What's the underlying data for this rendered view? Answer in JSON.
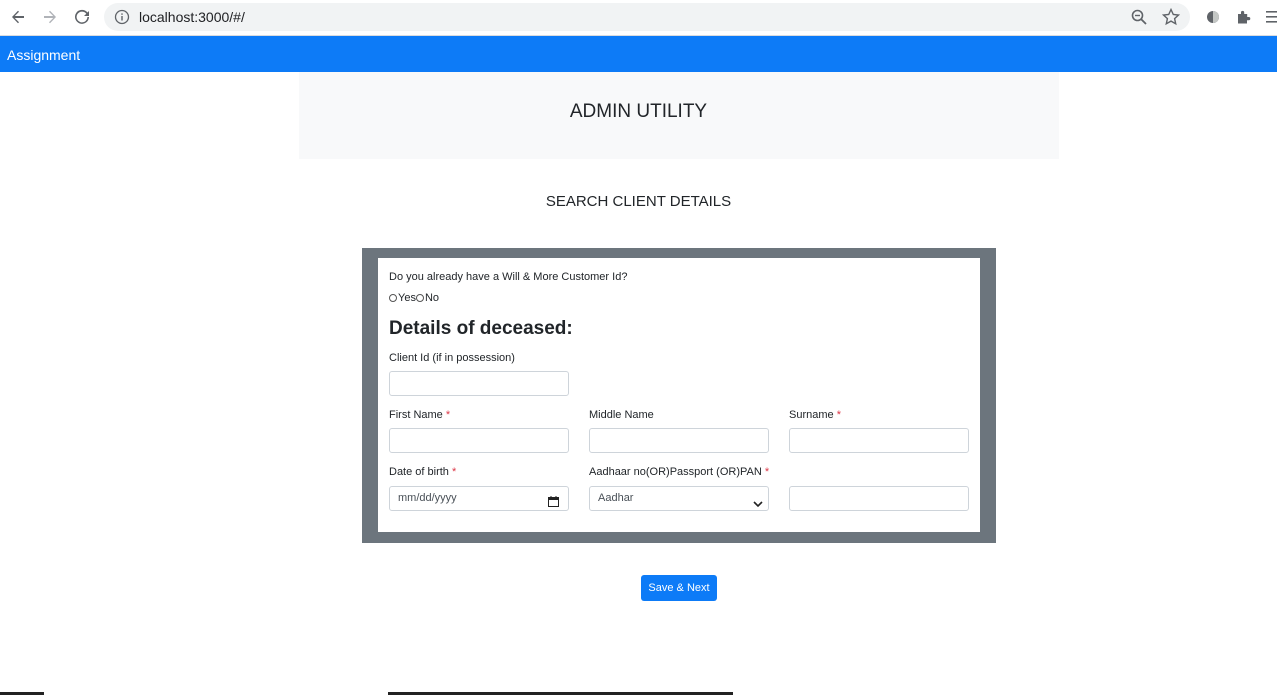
{
  "browser": {
    "url": "localhost:3000/#/"
  },
  "navbar": {
    "brand": "Assignment"
  },
  "header": {
    "title": "ADMIN UTILITY"
  },
  "search": {
    "title": "SEARCH CLIENT DETAILS"
  },
  "form": {
    "question": "Do you already have a Will & More Customer Id?",
    "radio_yes": "Yes",
    "radio_no": "No",
    "section_heading": "Details of deceased:",
    "client_id_label": "Client Id (if in possession)",
    "first_name_label": "First Name",
    "middle_name_label": "Middle Name",
    "surname_label": "Surname",
    "dob_label": "Date of birth",
    "dob_placeholder": "mm/dd/yyyy",
    "id_type_label": "Aadhaar no(OR)Passport (OR)PAN",
    "id_type_value": "Aadhar",
    "required_mark": "*"
  },
  "actions": {
    "save_next": "Save & Next"
  },
  "colors": {
    "primary": "#0d7bf7",
    "card_border": "#6c757d",
    "required": "#dc3545"
  }
}
